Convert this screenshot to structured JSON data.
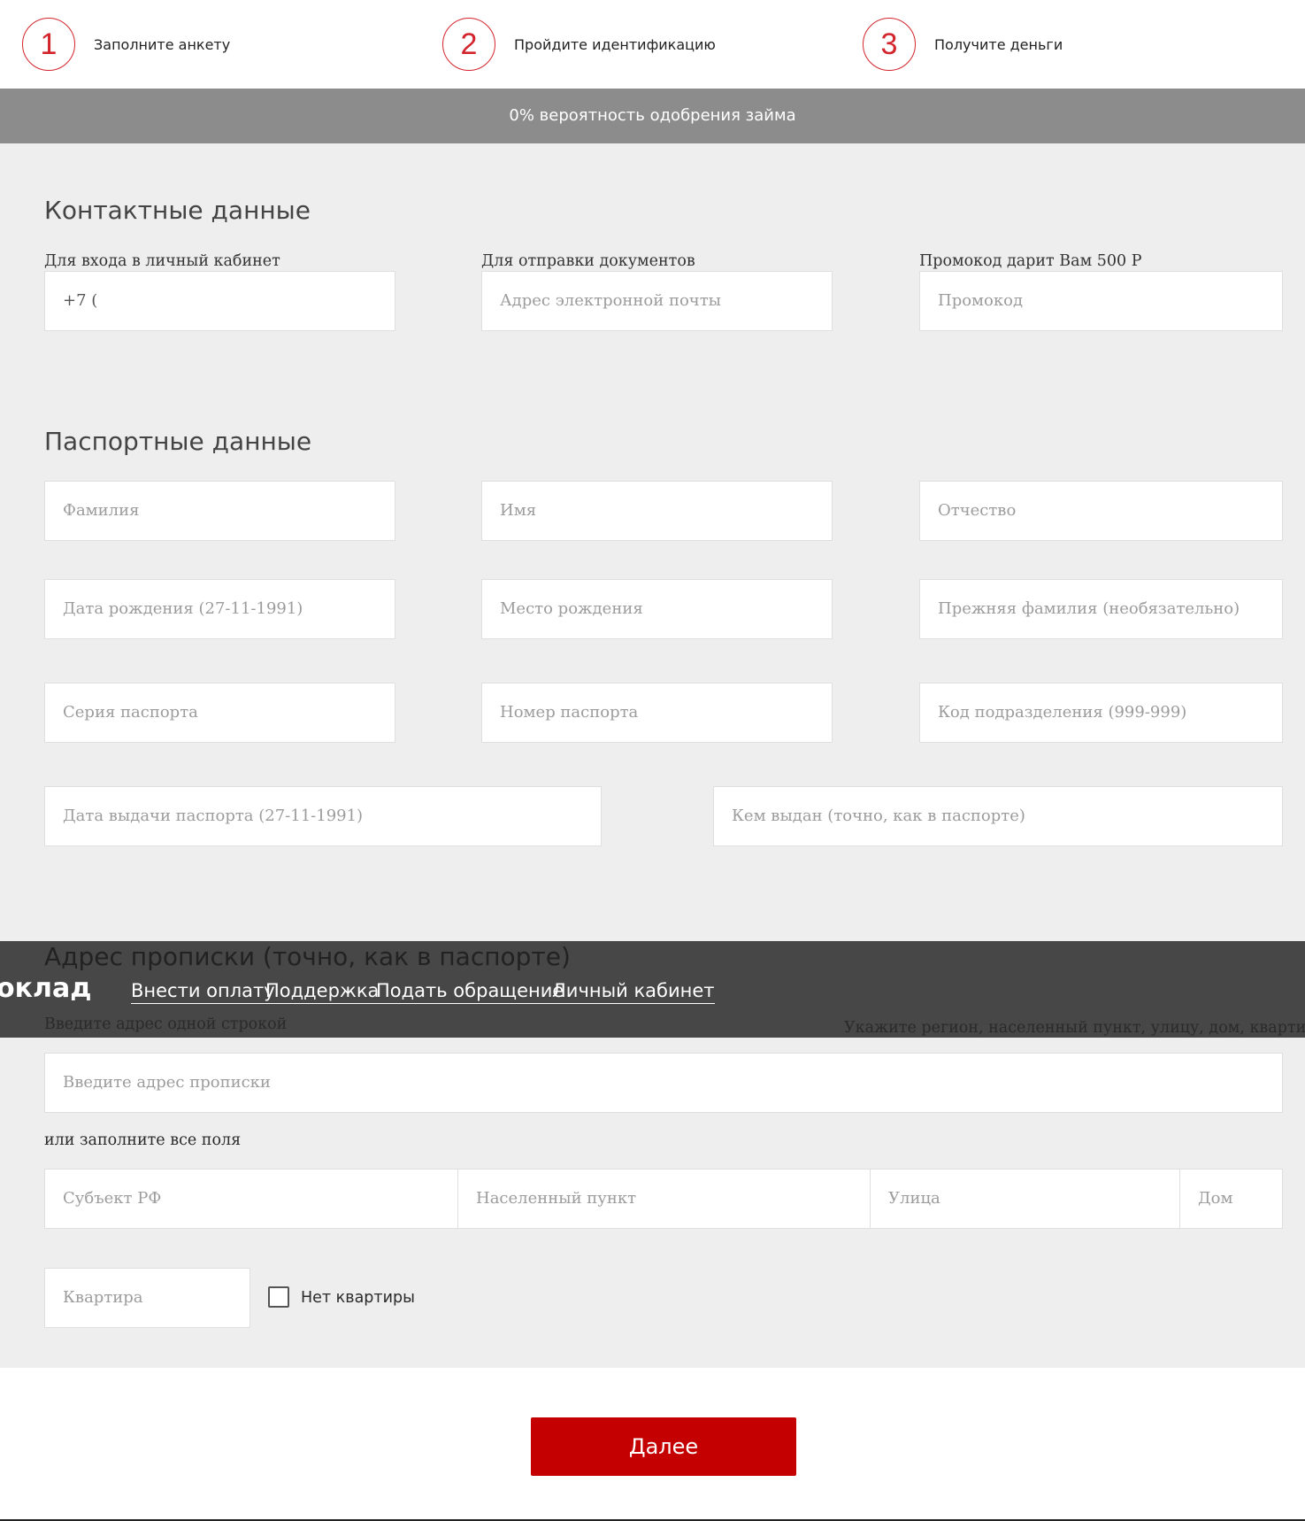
{
  "steps": [
    {
      "number": "1",
      "label": "Заполните анкету"
    },
    {
      "number": "2",
      "label": "Пройдите идентификацию"
    },
    {
      "number": "3",
      "label": "Получите деньги"
    }
  ],
  "banner": {
    "text": "0% вероятность одобрения займа"
  },
  "contact": {
    "title": "Контактные данные",
    "phone": {
      "label": "Для входа в личный кабинет",
      "value": "+7 ("
    },
    "email": {
      "label": "Для отправки документов",
      "placeholder": "Адрес электронной почты"
    },
    "promo": {
      "label": "Промокод дарит Вам 500 Р",
      "placeholder": "Промокод"
    }
  },
  "passport": {
    "title": "Паспортные данные",
    "surname": "Фамилия",
    "name": "Имя",
    "patronymic": "Отчество",
    "birth_date": "Дата рождения (27-11-1991)",
    "birth_place": "Место рождения",
    "previous_surname": "Прежняя фамилия (необязательно)",
    "series": "Серия паспорта",
    "number": "Номер паспорта",
    "division_code": "Код подразделения (999-999)",
    "issue_date": "Дата выдачи паспорта (27-11-1991)",
    "issued_by": "Кем выдан (точно, как в паспорте)"
  },
  "overlay_nav": {
    "logo_fragment": "оклад",
    "links": [
      "Внести оплату",
      "Поддержка",
      "Подать обращение",
      "Личный кабинет"
    ]
  },
  "address": {
    "title": "Адрес прописки (точно, как в паспорте)",
    "one_line_hint": "Введите адрес одной строкой",
    "right_hint": "Укажите регион, населенный пункт, улицу, дом, квартиру",
    "one_line_placeholder": "Введите адрес прописки",
    "or_fill_all": "или заполните все поля",
    "region": "Субъект РФ",
    "city": "Населенный пункт",
    "street": "Улица",
    "house": "Дом",
    "apartment": "Квартира",
    "no_apartment": "Нет квартиры"
  },
  "actions": {
    "next": "Далее"
  },
  "colors": {
    "accent": "#d3242c",
    "button": "#c40000",
    "banner": "#8c8c8c",
    "background": "#eeeeee",
    "dark_bar": "#474747"
  }
}
